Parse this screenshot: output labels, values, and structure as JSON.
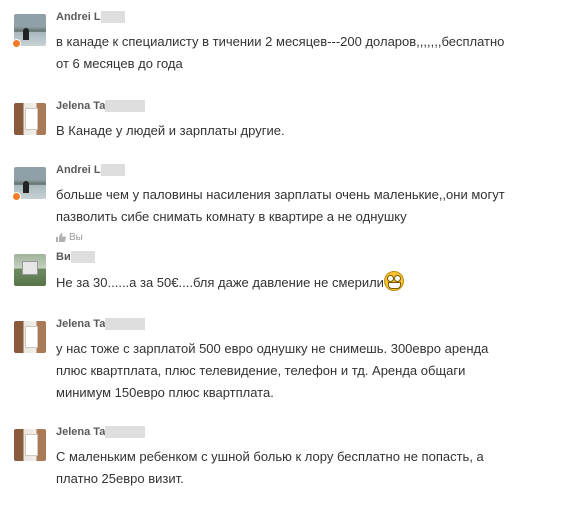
{
  "messages": [
    {
      "author": "Andrei L",
      "avatar_icon": "lake-photo-avatar",
      "online": true,
      "lines": [
        "в канаде к специалисту в тичении 2 месяцев---200 доларов,,,,,,,бесплатно",
        "от  6 месяцев  до года"
      ]
    },
    {
      "author": "Jelena Ta",
      "avatar_icon": "room-photo-avatar",
      "online": false,
      "lines": [
        "В Канаде у людей и зарплаты другие."
      ]
    },
    {
      "author": "Andrei L",
      "avatar_icon": "lake-photo-avatar",
      "online": true,
      "lines": [
        "больше чем у паловины насиления зарплаты очень маленькие,,они могут",
        "пазволить сибе снимать комнату в квартире а не однушку"
      ],
      "like_label": "Вы"
    },
    {
      "author": "Ви",
      "avatar_icon": "field-photo-avatar",
      "online": false,
      "lines": [
        "Не за 30......а за 50€....бля даже давление не смерили"
      ],
      "emoji": "grinning-emoji"
    },
    {
      "author": "Jelena Ta",
      "avatar_icon": "room-photo-avatar",
      "online": false,
      "lines": [
        "у нас тоже с зарплатой 500 евро однушку не снимешь. 300евро аренда",
        "плюс квартплата, плюс телевидение, телефон и тд. Аренда общаги",
        "минимум 150евро плюс квартплата."
      ]
    },
    {
      "author": "Jelena Ta",
      "avatar_icon": "room-photo-avatar",
      "online": false,
      "lines": [
        "С маленьким ребенком с ушной болью к лору бесплатно не попасть, а",
        "платно 25евро визит."
      ]
    }
  ],
  "colors": {
    "text": "#333333",
    "author": "#5a5a5a",
    "online_dot": "#f47b25",
    "like": "#9a9a9a",
    "redaction": "#dedede"
  }
}
